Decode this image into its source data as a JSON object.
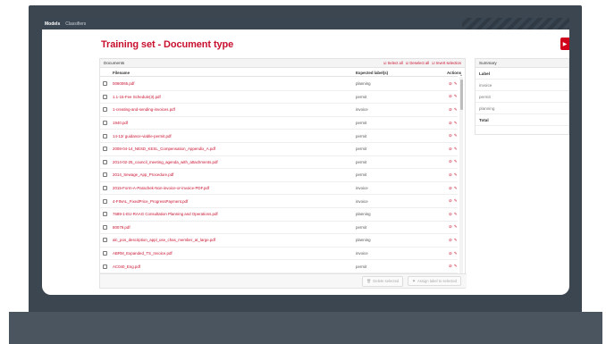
{
  "nav": {
    "items": [
      "Models",
      "Classifiers"
    ]
  },
  "page": {
    "title": "Training set - Document type"
  },
  "documents": {
    "panel_title": "Documents",
    "select_all": "Select all",
    "deselect_all": "Deselect all",
    "invert_selection": "Invert selection",
    "columns": {
      "filename": "Filename",
      "expected": "Expected label(s)",
      "actions": "Actions"
    },
    "rows": [
      {
        "filename": "0060065.pdf",
        "label": "planning"
      },
      {
        "filename": "1.1-15-Fee Schedule(3).pdf",
        "label": "permit"
      },
      {
        "filename": "1-creating-and-sending-invoices.pdf",
        "label": "invoice"
      },
      {
        "filename": "1940.pdf",
        "label": "permit"
      },
      {
        "filename": "14-12r guidance-viable-permit.pdf",
        "label": "permit"
      },
      {
        "filename": "2008-04-14_NESD_KESL_Compensation_Appendix_A.pdf",
        "label": "permit"
      },
      {
        "filename": "2014-02-25_council_meeting_agenda_with_attachments.pdf",
        "label": "permit"
      },
      {
        "filename": "2014_Sewage_App_Procedure.pdf",
        "label": "permit"
      },
      {
        "filename": "2015-Form-A-Parachek-Non-invoice-or-invoice-PDF.pdf",
        "label": "invoice"
      },
      {
        "filename": "4-FINAL_FixedPrice_ProgressPayment.pdf",
        "label": "invoice"
      },
      {
        "filename": "7689-1-EU-RAAG Consultation Planning and Operations.pdf",
        "label": "planning"
      },
      {
        "filename": "80079.pdf",
        "label": "permit"
      },
      {
        "filename": "alc_pos_description_appl_use_chas_member_at_large.pdf",
        "label": "planning"
      },
      {
        "filename": "ABRM_Expanded_TS_Invoice.pdf",
        "label": "invoice"
      },
      {
        "filename": "AC040_Eng.pdf",
        "label": "permit"
      }
    ],
    "delete_label": "Delete selected",
    "assign_label": "Assign label to selected"
  },
  "summary": {
    "panel_title": "Summary",
    "header": "Label",
    "rows": [
      "invoice",
      "permit",
      "planning"
    ],
    "total_label": "Total"
  },
  "colors": {
    "accent": "#c8102e",
    "nav_bg": "#3a4651",
    "bezel": "#3c4650"
  }
}
